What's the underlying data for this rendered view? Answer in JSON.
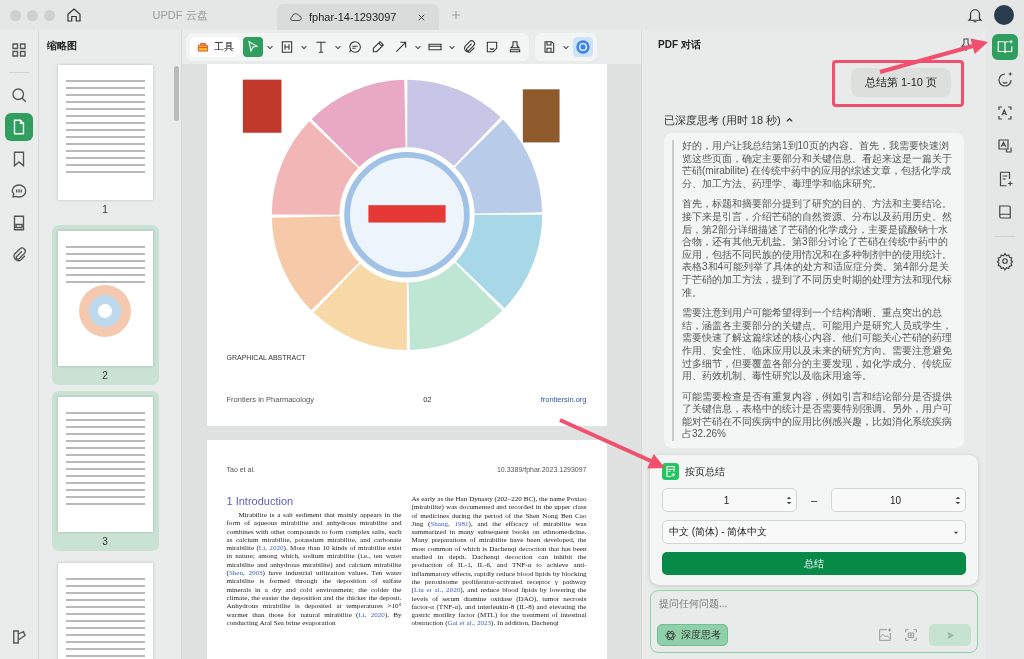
{
  "tabs": [
    {
      "label": "UPDF 云盘",
      "selected": false
    },
    {
      "label": "fphar-14-1293097",
      "selected": true
    }
  ],
  "left_rail": [
    {
      "selected": false
    },
    {
      "selected": false
    },
    {
      "selected": true
    },
    {
      "selected": false
    },
    {
      "selected": false
    },
    {
      "selected": false
    },
    {
      "selected": false
    }
  ],
  "thumbnails": {
    "title": "缩略图",
    "pages": [
      {
        "number": "1",
        "selected": false
      },
      {
        "number": "2",
        "selected": true
      },
      {
        "number": "3",
        "selected": true
      },
      {
        "selected": false
      }
    ]
  },
  "toolbar": {
    "tools_label": "工具",
    "tools": [
      {
        "selected": true
      },
      {
        "selected": false
      },
      {
        "selected": false
      },
      {
        "selected": false
      },
      {
        "selected": false
      },
      {
        "selected": false
      },
      {
        "selected": false
      },
      {
        "selected": false
      },
      {
        "selected": false
      },
      {
        "selected": false
      }
    ]
  },
  "document": {
    "figure_caption": "GRAPHICAL ABSTRACT",
    "footer": [
      "Frontiers in Pharmacology",
      "02",
      "frontiersin.org"
    ],
    "header": [
      "Tao et al.",
      "10.3389/fphar.2023.1293097"
    ],
    "heading": "1 Introduction",
    "columns": [
      [
        {
          "kind": "text",
          "text": "Mirabilite is a salt sediment that mainly appears in the form of aqueous mirabilite and anhydrous mirabilite and combines with other compounds to form complex salts, such as calcium mirabilite, potassium mirabilite, and carbonate mirabilite ("
        },
        {
          "kind": "citation",
          "text": "Li, 2020"
        },
        {
          "kind": "text",
          "text": "). More than 10 kinds of mirabilite exist in nature; among which, sodium mirabilite (i.e., ten water mirabilite and anhydrous mirabilite) and calcium mirabilite ("
        },
        {
          "kind": "citation",
          "text": "Shen, 2003"
        },
        {
          "kind": "text",
          "text": ") have industrial utilization values. Ten water mirabilite is formed through the deposition of sulfate minerals in a dry and cold environment; the colder the climate, the easier the deposition and the thicker the deposit. Anhydrous mirabilite is deposited at temperatures >10° warmer than those for natural mirabilite ("
        },
        {
          "kind": "citation",
          "text": "Li, 2020"
        },
        {
          "kind": "text",
          "text": "). By conducting Aral Sea brine evaporation"
        }
      ],
      [
        {
          "kind": "text",
          "text": "As early as the Han Dynasty (202–220 BC), the name Poxiao (mirabilite) was documented and recorded in the upper class of medicines during the period of the Shen Nong Ben Cao Jing ("
        },
        {
          "kind": "citation",
          "text": "Shang, 1981"
        },
        {
          "kind": "text",
          "text": "), and the efficacy of mirabilite was summarized in many subsequent books on ethnomedicine. Many preparations of mirabilite have been developed, the most common of which is Dachenqi decoction that has been studied in depth. Dachenqi decoction can inhibit the production of IL-1, IL-6, and TNF-α to achieve anti-inflammatory effects, rapidly reduce blood lipids by blocking the peroxisome proliferator-activated receptor γ pathway ("
        },
        {
          "kind": "citation",
          "text": "Liu et al., 2020"
        },
        {
          "kind": "text",
          "text": "), and reduce blood lipids by lowering the levels of serum diamine oxidase (DAO), tumor necrosis factor-α (TNF-α), and interleukin-8 (IL-8) and elevating the gastric motility factor (MTL) for the treatment of intestinal obstruction ("
        },
        {
          "kind": "citation",
          "text": "Gai et al., 2023"
        },
        {
          "kind": "text",
          "text": "). In addition, Dachenqi"
        }
      ]
    ]
  },
  "chat": {
    "title": "PDF 对话",
    "user_message": "总结第 1-10 页",
    "thinking_label": "已深度思考 (用时 18 秒)",
    "thinking_expanded": true,
    "thinking_paragraphs": [
      "好的，用户让我总结第1到10页的内容。首先，我需要快速浏览这些页面，确定主要部分和关键信息。看起来这是一篇关于芒硝(mirabilite) 在传统中药中的应用的综述文章，包括化学成分、加工方法、药理学、毒理学和临床研究。",
      "首先，标题和摘要部分提到了研究的目的、方法和主要结论。接下来是引言，介绍芒硝的自然资源、分布以及药用历史。然后，第2部分详细描述了芒硝的化学成分，主要是硫酸钠十水合物，还有其他无机盐。第3部分讨论了芒硝在传统中药中的应用，包括不同民族的使用情况和在多种制剂中的使用统计。表格3和4可能列举了具体的处方和适应症分类。第4部分是关于芒硝的加工方法，提到了不同历史时期的处理方法和现代标准。",
      "需要注意到用户可能希望得到一个结构清晰、重点突出的总结，涵盖各主要部分的关键点。可能用户是研究人员或学生，需要快速了解这篇综述的核心内容。他们可能关心芒硝的药理作用、安全性、临床应用以及未来的研究方向。需要注意避免过多细节，但要覆盖各部分的主要发现，如化学成分、传统应用、药效机制、毒性研究以及临床用途等。",
      "可能需要检查是否有重复内容，例如引言和结论部分是否提供了关键信息，表格中的统计是否需要特别强调。另外，用户可能对芒硝在不同疾病中的应用比例感兴趣，比如消化系统疾病占32.26%"
    ]
  },
  "summary_popup": {
    "title": "按页总结",
    "from": "1",
    "separator": "–",
    "to": "10",
    "language": "中文 (简体) - 简体中文",
    "button": "总结"
  },
  "input": {
    "placeholder": "提问任何问题...",
    "deep_think": {
      "label": "深度思考",
      "on": true
    },
    "send_disabled": true
  },
  "right_rail": [
    {
      "selected": true
    },
    {
      "selected": false
    },
    {
      "selected": false
    },
    {
      "selected": false
    },
    {
      "selected": false
    },
    {
      "selected": false
    },
    {
      "selected": false
    }
  ]
}
